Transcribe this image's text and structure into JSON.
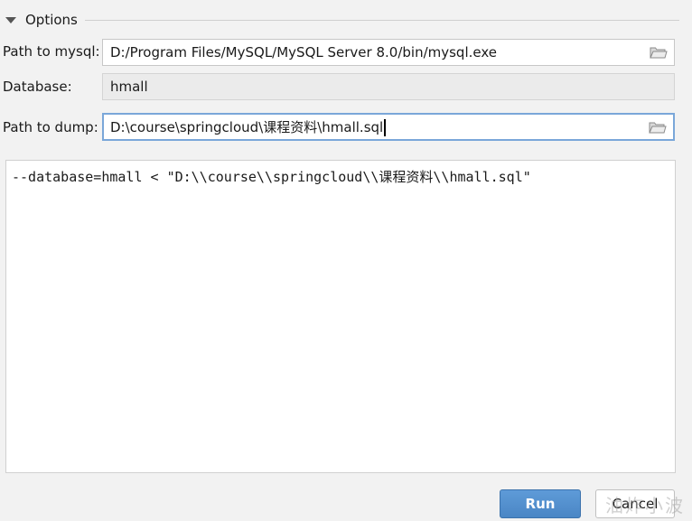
{
  "options": {
    "title": "Options"
  },
  "mysql_path": {
    "label": "Path to mysql:",
    "value": "D:/Program Files/MySQL/MySQL Server 8.0/bin/mysql.exe"
  },
  "database": {
    "label": "Database:",
    "value": "hmall"
  },
  "dump_path": {
    "label": "Path to dump:",
    "value": "D:\\course\\springcloud\\课程资料\\hmall.sql"
  },
  "command": {
    "text": "--database=hmall < \"D:\\\\course\\\\springcloud\\\\课程资料\\\\hmall.sql\""
  },
  "buttons": {
    "run": "Run",
    "cancel": "Cancel"
  },
  "watermark": {
    "text": "油炸小波"
  },
  "colors": {
    "run_button": "#4a86c5",
    "focus_border": "#7aa7d9",
    "background": "#f2f2f2"
  },
  "icons": {
    "collapse": "triangle-down-icon",
    "browse": "folder-icon"
  }
}
